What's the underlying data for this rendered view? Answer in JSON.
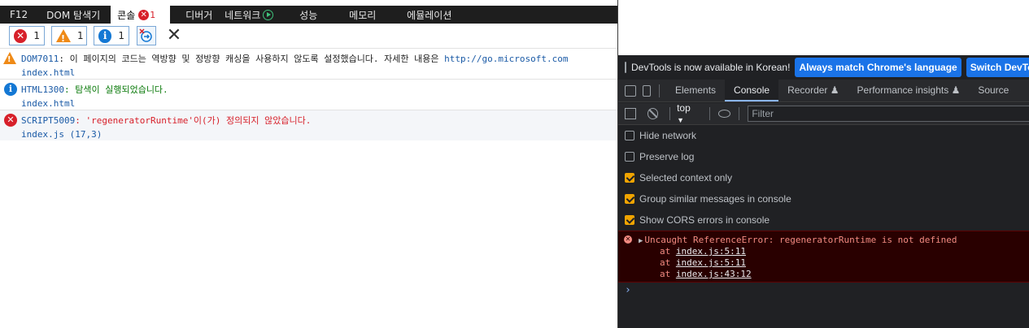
{
  "ie": {
    "tabs": [
      {
        "label": "F12"
      },
      {
        "label": "DOM 탐색기"
      },
      {
        "label": "콘솔",
        "error_badge": "1"
      },
      {
        "label": "디버거"
      },
      {
        "label": "네트워크"
      },
      {
        "label": "성능"
      },
      {
        "label": "메모리"
      },
      {
        "label": "에뮬레이션"
      }
    ],
    "filters": {
      "errors": "1",
      "warnings": "1",
      "info": "1"
    },
    "messages": [
      {
        "level": "warning",
        "code": "DOM7011",
        "text": "이 페이지의 코드는 역방향 및 정방향 캐싱을 사용하지 않도록 설정했습니다. 자세한 내용은",
        "link": "http://go.microsoft.com",
        "source": "index.html"
      },
      {
        "level": "info",
        "code": "HTML1300",
        "text": "탐색이 실행되었습니다.",
        "source": "index.html"
      },
      {
        "level": "error",
        "code": "SCRIPT5009",
        "text": "'regeneratorRuntime'이(가) 정의되지 않았습니다.",
        "source": "index.js (17,3)"
      }
    ]
  },
  "devtools": {
    "banner": {
      "text": "DevTools is now available in Korean!",
      "match_button": "Always match Chrome's language",
      "switch_button": "Switch DevTool"
    },
    "tabs": [
      "Elements",
      "Console",
      "Recorder ♟",
      "Performance insights ♟",
      "Source"
    ],
    "active_tab": "Console",
    "context": "top",
    "filter_placeholder": "Filter",
    "settings": [
      {
        "label": "Hide network",
        "checked": false
      },
      {
        "label": "Preserve log",
        "checked": false
      },
      {
        "label": "Selected context only",
        "checked": true
      },
      {
        "label": "Group similar messages in console",
        "checked": true
      },
      {
        "label": "Show CORS errors in console",
        "checked": true
      }
    ],
    "error": {
      "message": "Uncaught ReferenceError: regeneratorRuntime is not defined",
      "stack": [
        {
          "prefix": "at",
          "location": "index.js:5:11"
        },
        {
          "prefix": "at",
          "location": "index.js:5:11"
        },
        {
          "prefix": "at",
          "location": "index.js:43:12"
        }
      ]
    },
    "prompt": "›"
  },
  "colors": {
    "ie_error": "#d7202a",
    "ie_warning": "#ef8a17",
    "ie_info": "#1478d4",
    "devtools_bg": "#202124",
    "devtools_accent": "#1a73e8",
    "devtools_error_bg": "#290000",
    "checkbox_on": "#f0a400"
  }
}
